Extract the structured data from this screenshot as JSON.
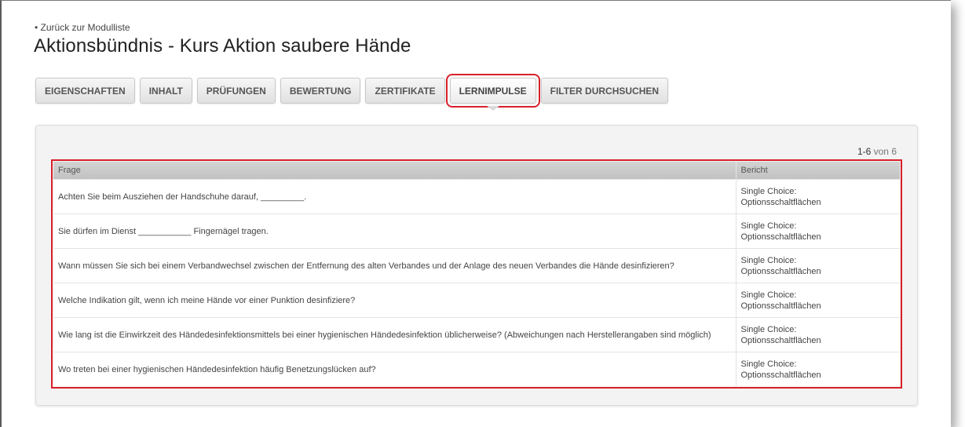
{
  "back_link": "• Zurück zur Modulliste",
  "title": "Aktionsbündnis - Kurs Aktion saubere Hände",
  "tabs": [
    {
      "label": "EIGENSCHAFTEN",
      "active": false
    },
    {
      "label": "INHALT",
      "active": false
    },
    {
      "label": "PRÜFUNGEN",
      "active": false
    },
    {
      "label": "BEWERTUNG",
      "active": false
    },
    {
      "label": "ZERTIFIKATE",
      "active": false
    },
    {
      "label": "LERNIMPULSE",
      "active": true
    },
    {
      "label": "FILTER DURCHSUCHEN",
      "active": false
    }
  ],
  "pager": {
    "range": "1-6",
    "suffix": " von 6"
  },
  "table": {
    "headers": {
      "question": "Frage",
      "report": "Bericht"
    },
    "rows": [
      {
        "question": "Achten Sie beim Ausziehen der Handschuhe darauf, _________.",
        "report_line1": "Single Choice:",
        "report_line2": "Optionsschaltflächen"
      },
      {
        "question": "Sie dürfen im Dienst ___________ Fingernägel tragen.",
        "report_line1": "Single Choice:",
        "report_line2": "Optionsschaltflächen"
      },
      {
        "question": "Wann müssen Sie sich bei einem Verbandwechsel zwischen der Entfernung des alten Verbandes und der Anlage des neuen Verbandes die Hände desinfizieren?",
        "report_line1": "Single Choice:",
        "report_line2": "Optionsschaltflächen"
      },
      {
        "question": "Welche Indikation gilt, wenn ich meine Hände vor einer Punktion desinfiziere?",
        "report_line1": "Single Choice:",
        "report_line2": "Optionsschaltflächen"
      },
      {
        "question": "Wie lang ist die Einwirkzeit des Händedesinfektionsmittels bei einer hygienischen Händedesinfektion üblicherweise? (Abweichungen nach Herstellerangaben sind möglich)",
        "report_line1": "Single Choice:",
        "report_line2": "Optionsschaltflächen"
      },
      {
        "question": "Wo treten bei einer hygienischen Händedesinfektion häufig Benetzungslücken auf?",
        "report_line1": "Single Choice:",
        "report_line2": "Optionsschaltflächen"
      }
    ]
  },
  "colors": {
    "highlight": "#d8202a",
    "tab_bg": "#e6e6e6",
    "header_bg": "#c8c8c8"
  }
}
